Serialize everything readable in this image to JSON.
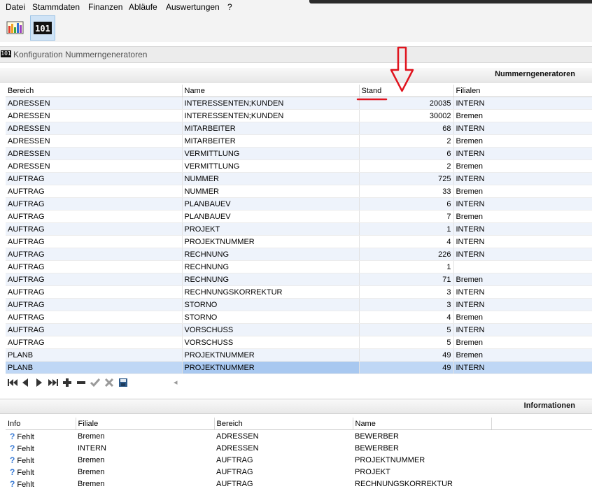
{
  "menu": [
    "Datei",
    "Stammdaten",
    "Finanzen",
    "Abläufe",
    "Auswertungen",
    "?"
  ],
  "toolbar": {
    "buttons": [
      {
        "name": "stammdaten-chart-icon"
      },
      {
        "name": "nummerngenerator-icon",
        "label": "101"
      }
    ]
  },
  "document": {
    "icon_label": "101",
    "title": "Konfiguration Nummerngeneratoren"
  },
  "generators": {
    "title": "Nummerngeneratoren",
    "columns": [
      "Bereich",
      "Name",
      "Stand",
      "Filialen"
    ],
    "rows": [
      [
        "ADRESSEN",
        "INTERESSENTEN;KUNDEN",
        "20035",
        "INTERN"
      ],
      [
        "ADRESSEN",
        "INTERESSENTEN;KUNDEN",
        "30002",
        "Bremen"
      ],
      [
        "ADRESSEN",
        "MITARBEITER",
        "68",
        "INTERN"
      ],
      [
        "ADRESSEN",
        "MITARBEITER",
        "2",
        "Bremen"
      ],
      [
        "ADRESSEN",
        "VERMITTLUNG",
        "6",
        "INTERN"
      ],
      [
        "ADRESSEN",
        "VERMITTLUNG",
        "2",
        "Bremen"
      ],
      [
        "AUFTRAG",
        "NUMMER",
        "725",
        "INTERN"
      ],
      [
        "AUFTRAG",
        "NUMMER",
        "33",
        "Bremen"
      ],
      [
        "AUFTRAG",
        "PLANBAUEV",
        "6",
        "INTERN"
      ],
      [
        "AUFTRAG",
        "PLANBAUEV",
        "7",
        "Bremen"
      ],
      [
        "AUFTRAG",
        "PROJEKT",
        "1",
        "INTERN"
      ],
      [
        "AUFTRAG",
        "PROJEKTNUMMER",
        "4",
        "INTERN"
      ],
      [
        "AUFTRAG",
        "RECHNUNG",
        "226",
        "INTERN"
      ],
      [
        "AUFTRAG",
        "RECHNUNG",
        "1",
        ""
      ],
      [
        "AUFTRAG",
        "RECHNUNG",
        "71",
        "Bremen"
      ],
      [
        "AUFTRAG",
        "RECHNUNGSKORREKTUR",
        "3",
        "INTERN"
      ],
      [
        "AUFTRAG",
        "STORNO",
        "3",
        "INTERN"
      ],
      [
        "AUFTRAG",
        "STORNO",
        "4",
        "Bremen"
      ],
      [
        "AUFTRAG",
        "VORSCHUSS",
        "5",
        "INTERN"
      ],
      [
        "AUFTRAG",
        "VORSCHUSS",
        "5",
        "Bremen"
      ],
      [
        "PLANB",
        "PROJEKTNUMMER",
        "49",
        "Bremen"
      ],
      [
        "PLANB",
        "PROJEKTNUMMER",
        "49",
        "INTERN"
      ]
    ],
    "selected_row": 21
  },
  "navigator": [
    "first-record-icon",
    "prior-record-icon",
    "next-record-icon",
    "last-record-icon",
    "insert-record-icon",
    "delete-record-icon",
    "post-edit-icon",
    "cancel-edit-icon",
    "save-icon"
  ],
  "informationen": {
    "title": "Informationen",
    "columns": [
      "Info",
      "Filiale",
      "Bereich",
      "Name"
    ],
    "rows": [
      [
        "Fehlt",
        "Bremen",
        "ADRESSEN",
        "BEWERBER"
      ],
      [
        "Fehlt",
        "INTERN",
        "ADRESSEN",
        "BEWERBER"
      ],
      [
        "Fehlt",
        "Bremen",
        "AUFTRAG",
        "PROJEKTNUMMER"
      ],
      [
        "Fehlt",
        "Bremen",
        "AUFTRAG",
        "PROJEKT"
      ],
      [
        "Fehlt",
        "Bremen",
        "AUFTRAG",
        "RECHNUNGSKORREKTUR"
      ]
    ]
  },
  "annotation": {
    "color": "#e0141e"
  },
  "colors": {
    "selection": "#bfd7f5",
    "row_alt": "#eef3fb"
  }
}
